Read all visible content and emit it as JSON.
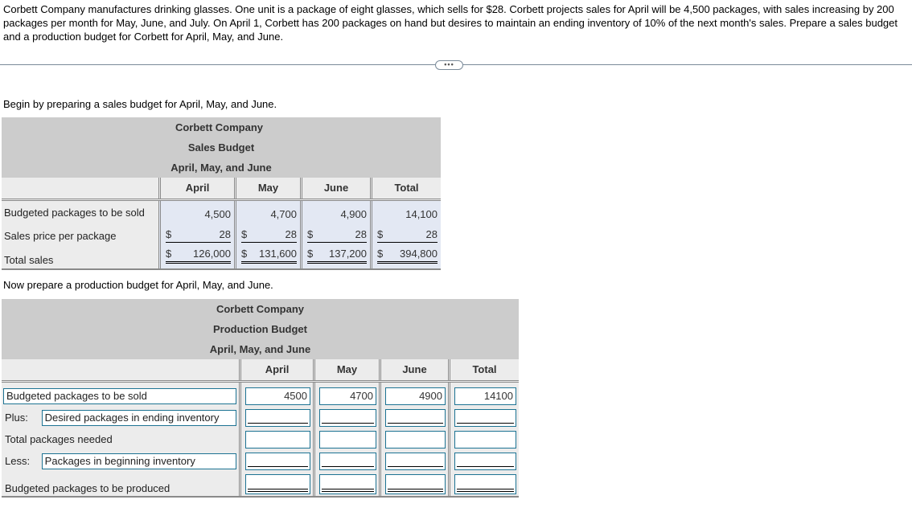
{
  "problem": {
    "text": "Corbett Company manufactures drinking glasses. One unit is a package of eight glasses, which sells for $28. Corbett projects sales for April will be 4,500 packages, with sales increasing by 200 packages per month for May, June, and July. On April 1, Corbett has 200 packages on hand but desires to maintain an ending inventory of 10% of the next month's sales. Prepare a sales budget and a production budget for Corbett for April, May, and June."
  },
  "divider": {
    "ellipsis_label": "•••",
    "icon": "more-icon"
  },
  "sales_section": {
    "instruction": "Begin by preparing a sales budget for April, May, and June.",
    "title_lines": [
      "Corbett Company",
      "Sales Budget",
      "April, May, and June"
    ],
    "columns": [
      "April",
      "May",
      "June",
      "Total"
    ],
    "rows": [
      {
        "label": "Budgeted packages to be sold",
        "currency": [
          "",
          "",
          "",
          ""
        ],
        "values": [
          "4,500",
          "4,700",
          "4,900",
          "14,100"
        ]
      },
      {
        "label": "Sales price per package",
        "currency": [
          "$",
          "$",
          "$",
          "$"
        ],
        "values": [
          "28",
          "28",
          "28",
          "28"
        ]
      },
      {
        "label": "Total sales",
        "currency": [
          "$",
          "$",
          "$",
          "$"
        ],
        "values": [
          "126,000",
          "131,600",
          "137,200",
          "394,800"
        ]
      }
    ]
  },
  "production_section": {
    "instruction": "Now prepare a production budget for April, May, and June.",
    "title_lines": [
      "Corbett Company",
      "Production Budget",
      "April, May, and June"
    ],
    "columns": [
      "April",
      "May",
      "June",
      "Total"
    ],
    "rows": [
      {
        "prefix": "",
        "label": "Budgeted packages to be sold",
        "label_is_input": true,
        "values": [
          "4500",
          "4700",
          "4900",
          "14100"
        ]
      },
      {
        "prefix": "Plus:",
        "label": "Desired packages in ending inventory",
        "label_is_input": true,
        "values": [
          "",
          "",
          "",
          ""
        ]
      },
      {
        "prefix": "",
        "label": "Total packages needed",
        "label_is_input": false,
        "values": [
          "",
          "",
          "",
          ""
        ]
      },
      {
        "prefix": "Less:",
        "label": "Packages in beginning inventory",
        "label_is_input": true,
        "values": [
          "",
          "",
          "",
          ""
        ]
      },
      {
        "prefix": "",
        "label": "Budgeted packages to be produced",
        "label_is_input": false,
        "values": [
          "",
          "",
          "",
          ""
        ]
      }
    ]
  }
}
